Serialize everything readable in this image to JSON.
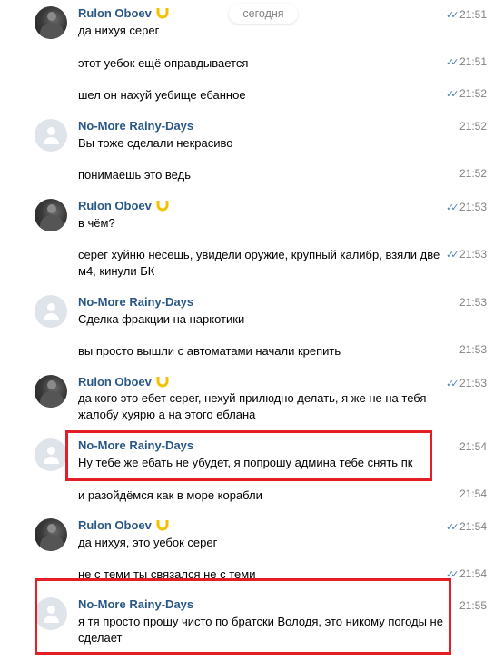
{
  "date_pill": "сегодня",
  "colors": {
    "author": "#2a5885",
    "time": "#828282",
    "check": "#5181b8",
    "highlight": "#e31e24"
  },
  "messages": [
    {
      "author": "Rulon Oboev",
      "text": "да нихуя серег",
      "time": "21:51"
    },
    {
      "text": "этот уебок ещё оправдывается",
      "time": "21:51"
    },
    {
      "text": "шел он нахуй уебище ебанное",
      "time": "21:52"
    },
    {
      "author": "No-More Rainy-Days",
      "text": "Вы тоже сделали некрасиво",
      "time": "21:52"
    },
    {
      "text": "понимаешь это ведь",
      "time": "21:52"
    },
    {
      "author": "Rulon Oboev",
      "text": "в чём?",
      "time": "21:53"
    },
    {
      "text": "серег хуйню несешь, увидели оружие, крупный калибр, взяли две м4, кинули БК",
      "time": "21:53"
    },
    {
      "author": "No-More Rainy-Days",
      "text": "Сделка фракции на наркотики",
      "time": "21:53"
    },
    {
      "text": "вы просто вышли с автоматами начали крепить",
      "time": "21:53"
    },
    {
      "author": "Rulon Oboev",
      "text": "да кого это ебет серег, нехуй прилюдно делать, я же не на тебя жалобу хуярю а на этого еблана",
      "time": "21:53"
    },
    {
      "author": "No-More Rainy-Days",
      "text": "Ну тебе же ебать не убудет, я попрошу админа тебе снять пк",
      "time": "21:54"
    },
    {
      "text": "и разойдёмся как в море корабли",
      "time": "21:54"
    },
    {
      "author": "Rulon Oboev",
      "text": "да нихуя, это уебок серег",
      "time": "21:54"
    },
    {
      "text": "не с теми ты связался не с теми",
      "time": "21:54"
    },
    {
      "author": "No-More Rainy-Days",
      "text": "я тя просто прошу чисто по братски Володя, это никому погоды не сделает",
      "time": "21:55"
    }
  ]
}
